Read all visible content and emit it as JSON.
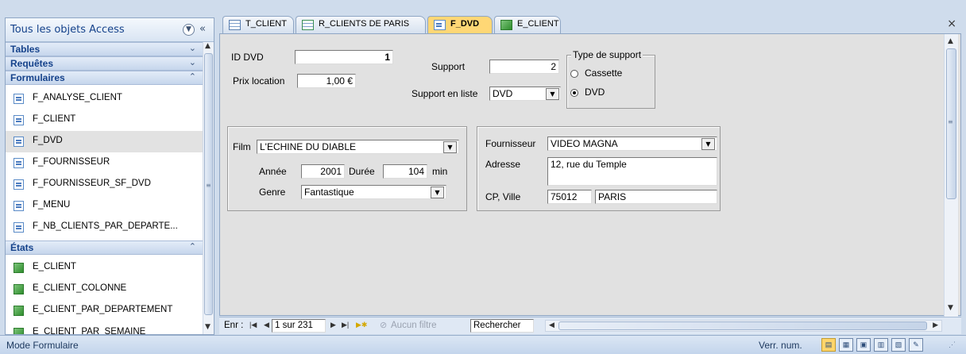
{
  "nav": {
    "title": "Tous les objets Access",
    "groups": [
      {
        "label": "Tables",
        "chevron": "double-chevron-down"
      },
      {
        "label": "Requêtes",
        "chevron": "double-chevron-down"
      },
      {
        "label": "Formulaires",
        "chevron": "double-chevron-up"
      },
      {
        "label": "États",
        "chevron": "double-chevron-up"
      }
    ],
    "forms": [
      "F_ANALYSE_CLIENT",
      "F_CLIENT",
      "F_DVD",
      "F_FOURNISSEUR",
      "F_FOURNISSEUR_SF_DVD",
      "F_MENU",
      "F_NB_CLIENTS_PAR_DEPARTE..."
    ],
    "reports": [
      "E_CLIENT",
      "E_CLIENT_COLONNE",
      "E_CLIENT_PAR_DEPARTEMENT",
      "E_CLIENT_PAR_SEMAINE"
    ],
    "selected": "F_DVD"
  },
  "tabs": [
    {
      "label": "T_CLIENT",
      "icon": "table-icon"
    },
    {
      "label": "R_CLIENTS DE PARIS",
      "icon": "query-icon"
    },
    {
      "label": "F_DVD",
      "icon": "form-icon",
      "active": true
    },
    {
      "label": "E_CLIENT",
      "icon": "report-icon"
    }
  ],
  "close_glyph": "×",
  "form": {
    "id_label": "ID DVD",
    "id_value": "1",
    "prix_label": "Prix location",
    "prix_value": "1,00 €",
    "support_label": "Support",
    "support_value": "2",
    "support_liste_label": "Support en liste",
    "support_liste_value": "DVD",
    "type_support_label": "Type de support",
    "opt_cassette": "Cassette",
    "opt_dvd": "DVD",
    "selected_option": "DVD",
    "film_label": "Film",
    "film_value": "L'ECHINE DU DIABLE",
    "annee_label": "Année",
    "annee_value": "2001",
    "duree_label": "Durée",
    "duree_value": "104",
    "duree_unit": "min",
    "genre_label": "Genre",
    "genre_value": "Fantastique",
    "fournisseur_label": "Fournisseur",
    "fournisseur_value": "VIDEO MAGNA",
    "adresse_label": "Adresse",
    "adresse_value": "12, rue du Temple",
    "cpville_label": "CP, Ville",
    "cp_value": "75012",
    "ville_value": "PARIS"
  },
  "recnav": {
    "label": "Enr :",
    "position": "1 sur 231",
    "filter_label": "Aucun filtre",
    "search_label": "Rechercher"
  },
  "status": {
    "mode": "Mode Formulaire",
    "numlock": "Verr. num."
  },
  "colors": {
    "active_tab": "#ffd775",
    "accent": "#15428b",
    "form_bg": "#e1e1e1"
  }
}
